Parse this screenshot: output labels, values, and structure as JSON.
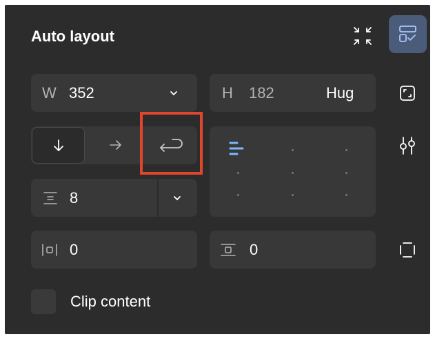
{
  "panel": {
    "title": "Auto layout"
  },
  "width": {
    "label": "W",
    "value": "352"
  },
  "height": {
    "label": "H",
    "value": "182",
    "mode": "Hug"
  },
  "direction": {
    "options": [
      "vertical",
      "horizontal",
      "wrap"
    ],
    "selected": "vertical",
    "highlighted": "wrap"
  },
  "gap": {
    "value": "8"
  },
  "padding": {
    "horizontal": "0",
    "vertical": "0"
  },
  "alignment": {
    "selected": "top-left"
  },
  "clip": {
    "label": "Clip content",
    "checked": false
  },
  "colors": {
    "panel_bg": "#2c2c2c",
    "field_bg": "#383838",
    "accent": "#7cb8ff",
    "active_button_bg": "#4a5c7a",
    "highlight_box": "#e0462c"
  }
}
